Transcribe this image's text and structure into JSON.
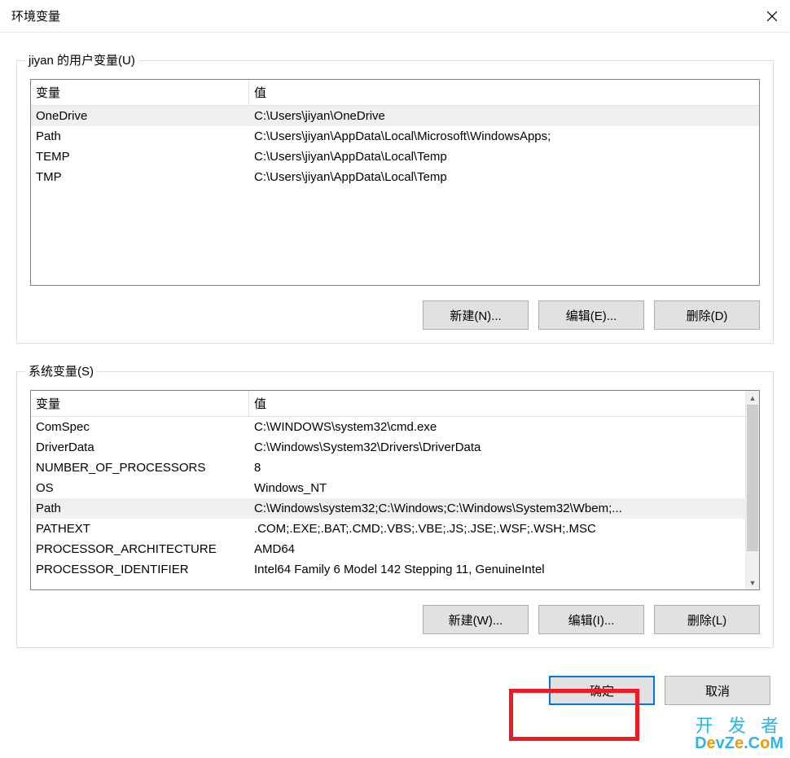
{
  "window": {
    "title": "环境变量"
  },
  "user_section": {
    "label": "jiyan 的用户变量(U)",
    "columns": {
      "var": "变量",
      "val": "值"
    },
    "rows": [
      {
        "var": "OneDrive",
        "val": "C:\\Users\\jiyan\\OneDrive",
        "selected": true
      },
      {
        "var": "Path",
        "val": "C:\\Users\\jiyan\\AppData\\Local\\Microsoft\\WindowsApps;",
        "selected": false
      },
      {
        "var": "TEMP",
        "val": "C:\\Users\\jiyan\\AppData\\Local\\Temp",
        "selected": false
      },
      {
        "var": "TMP",
        "val": "C:\\Users\\jiyan\\AppData\\Local\\Temp",
        "selected": false
      }
    ],
    "buttons": {
      "new": "新建(N)...",
      "edit": "编辑(E)...",
      "delete": "删除(D)"
    }
  },
  "system_section": {
    "label": "系统变量(S)",
    "columns": {
      "var": "变量",
      "val": "值"
    },
    "rows": [
      {
        "var": "ComSpec",
        "val": "C:\\WINDOWS\\system32\\cmd.exe",
        "selected": false
      },
      {
        "var": "DriverData",
        "val": "C:\\Windows\\System32\\Drivers\\DriverData",
        "selected": false
      },
      {
        "var": "NUMBER_OF_PROCESSORS",
        "val": "8",
        "selected": false
      },
      {
        "var": "OS",
        "val": "Windows_NT",
        "selected": false
      },
      {
        "var": "Path",
        "val": "C:\\Windows\\system32;C:\\Windows;C:\\Windows\\System32\\Wbem;...",
        "selected": true
      },
      {
        "var": "PATHEXT",
        "val": ".COM;.EXE;.BAT;.CMD;.VBS;.VBE;.JS;.JSE;.WSF;.WSH;.MSC",
        "selected": false
      },
      {
        "var": "PROCESSOR_ARCHITECTURE",
        "val": "AMD64",
        "selected": false
      },
      {
        "var": "PROCESSOR_IDENTIFIER",
        "val": "Intel64 Family 6 Model 142 Stepping 11, GenuineIntel",
        "selected": false
      }
    ],
    "buttons": {
      "new": "新建(W)...",
      "edit": "编辑(I)...",
      "delete": "删除(L)"
    }
  },
  "dialog_buttons": {
    "ok": "确定",
    "cancel": "取消"
  },
  "watermark": {
    "line1": "开 发 者",
    "line2a": "D",
    "line2b": "e",
    "line2c": "vZ",
    "line2d": "e",
    "line2e": ".C",
    "line2f": "o",
    "line2g": "M"
  }
}
